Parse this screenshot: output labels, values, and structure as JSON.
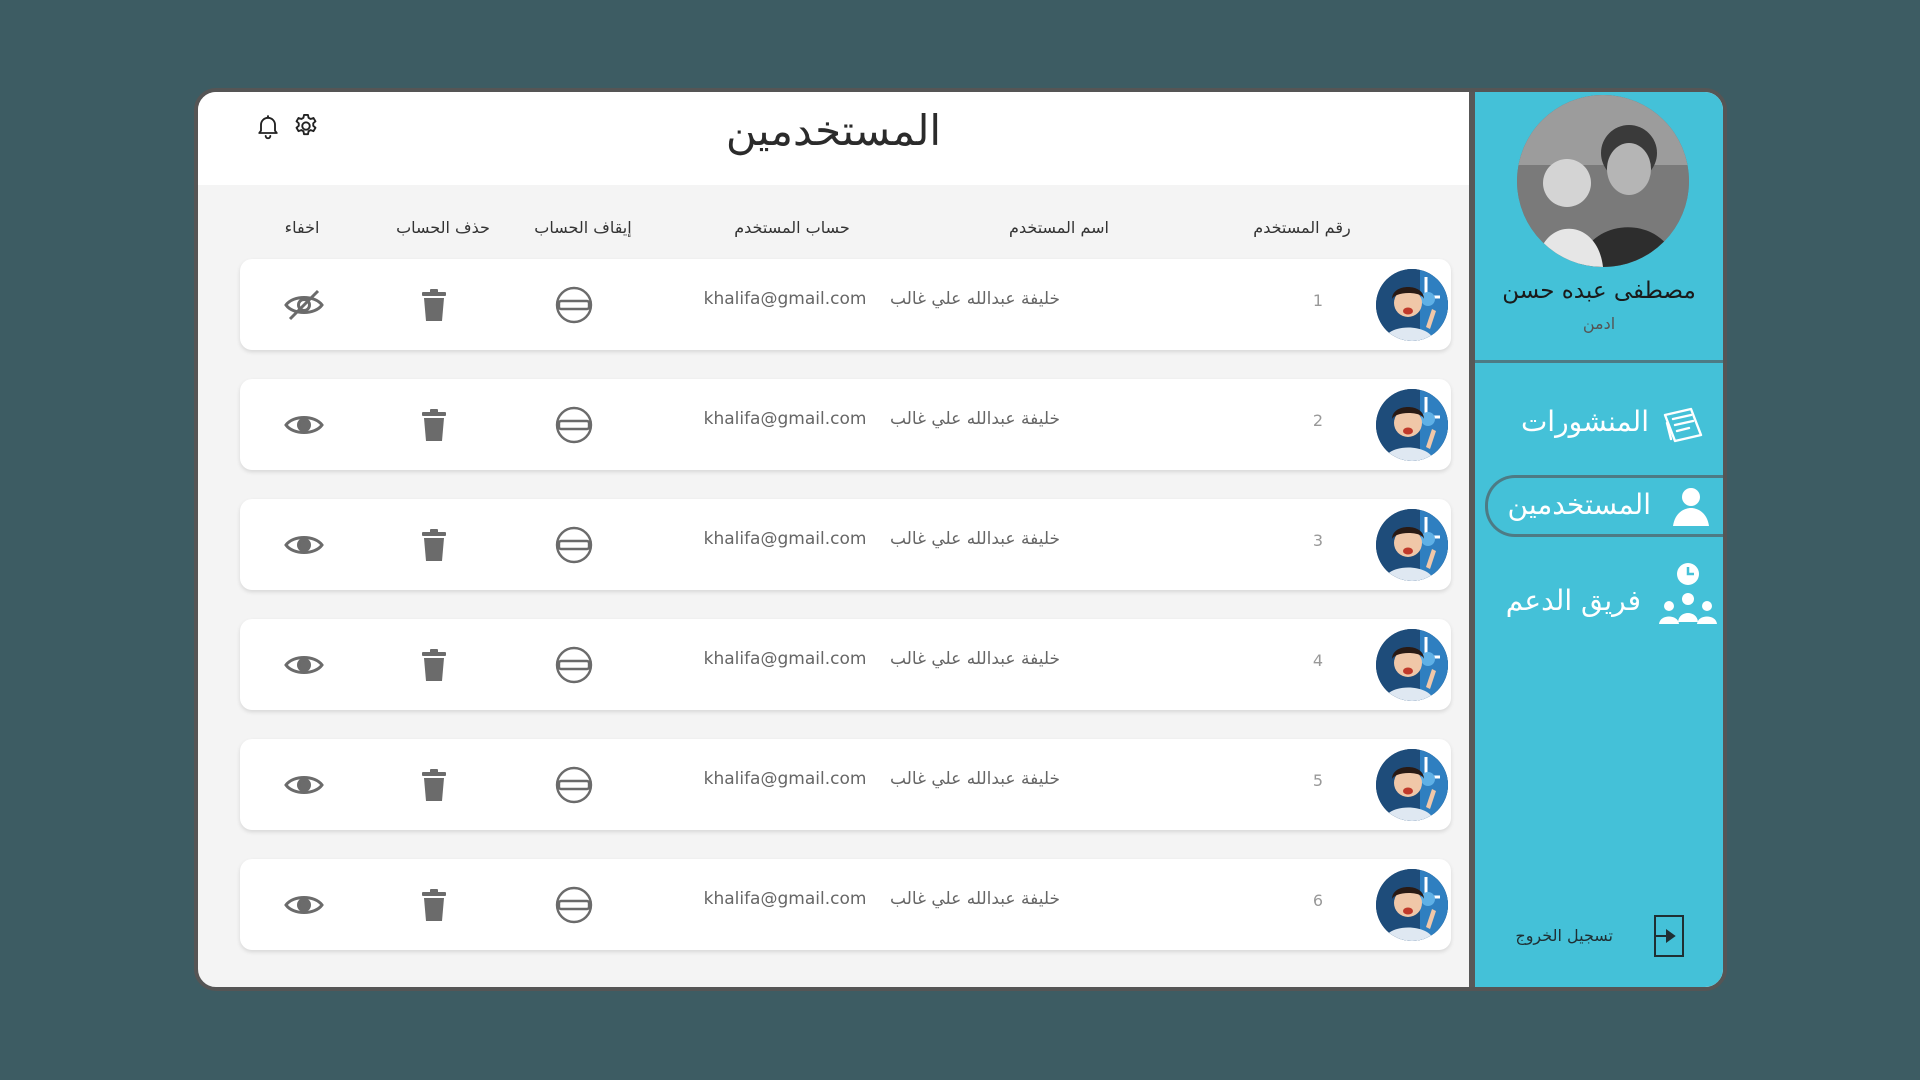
{
  "header": {
    "title": "المستخدمين",
    "icons": [
      "bell-icon",
      "gear-icon"
    ]
  },
  "table": {
    "columns": {
      "id": "رقم المستخدم",
      "name": "اسم المستخدم",
      "account": "حساب المستخدم",
      "suspend": "إيقاف الحساب",
      "delete": "حذف الحساب",
      "hide": "اخفاء"
    },
    "rows": [
      {
        "id": "1",
        "name": "خليفة عبدالله علي غالب",
        "email": "khalifa@gmail.com",
        "hidden": true
      },
      {
        "id": "2",
        "name": "خليفة عبدالله علي غالب",
        "email": "khalifa@gmail.com",
        "hidden": false
      },
      {
        "id": "3",
        "name": "خليفة عبدالله علي غالب",
        "email": "khalifa@gmail.com",
        "hidden": false
      },
      {
        "id": "4",
        "name": "خليفة عبدالله علي غالب",
        "email": "khalifa@gmail.com",
        "hidden": false
      },
      {
        "id": "5",
        "name": "خليفة عبدالله علي غالب",
        "email": "khalifa@gmail.com",
        "hidden": false
      },
      {
        "id": "6",
        "name": "خليفة عبدالله علي غالب",
        "email": "khalifa@gmail.com",
        "hidden": false
      }
    ]
  },
  "sidebar": {
    "profile": {
      "name": "مصطفى عبده  حسن",
      "role": "ادمن"
    },
    "items": [
      {
        "label": "المنشورات",
        "icon": "posts-icon"
      },
      {
        "label": "المستخدمين",
        "icon": "user-icon",
        "active": true
      },
      {
        "label": "فريق الدعم",
        "icon": "support-team-icon"
      }
    ],
    "logout_label": "تسجيل الخروج"
  },
  "colors": {
    "background": "#3d5c63",
    "sidebar": "#44c1d8",
    "frame_border": "#555555",
    "icon_gray": "#6b6b6b"
  }
}
